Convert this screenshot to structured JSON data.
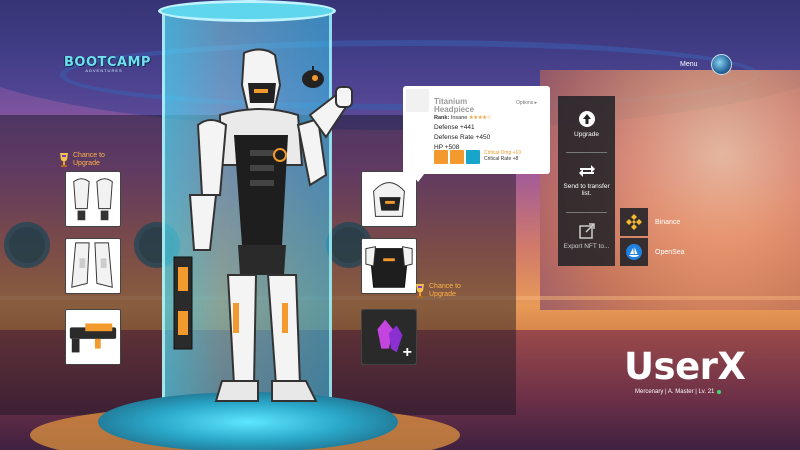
{
  "header": {
    "logo_main": "BOOTCAMP",
    "logo_sub": "ADVENTURES",
    "menu_label": "Menu"
  },
  "equipment": {
    "chance_label": "Chance to Upgrade"
  },
  "tooltip": {
    "title": "Titanium Headpiece",
    "options_label": "Options ▸",
    "rank_label": "Rank:",
    "rank_value": "Insane",
    "rank_stars": "★★★★☆",
    "rank_rating": 4,
    "stats": [
      "Defense +441",
      "Defense Rate +450",
      "HP +508"
    ],
    "bonus_1": "Critical Dmg +10",
    "bonus_2": "Critical Rate +8"
  },
  "actions": {
    "upgrade": "Upgrade",
    "transfer": "Send to transfer list.",
    "export": "Export NFT to..."
  },
  "marketplaces": {
    "binance": "Binance",
    "opensea": "OpenSea"
  },
  "user": {
    "name": "UserX",
    "details": "Mercenary | A. Master | Lv. 21"
  },
  "colors": {
    "accent_orange": "#f29a2e",
    "accent_cyan": "#6ee0f0",
    "online": "#3ddc6b"
  },
  "icons": [
    "trophy-icon",
    "upgrade-arrow-icon",
    "transfer-arrows-icon",
    "export-icon",
    "binance-icon",
    "opensea-icon",
    "plus-icon"
  ]
}
